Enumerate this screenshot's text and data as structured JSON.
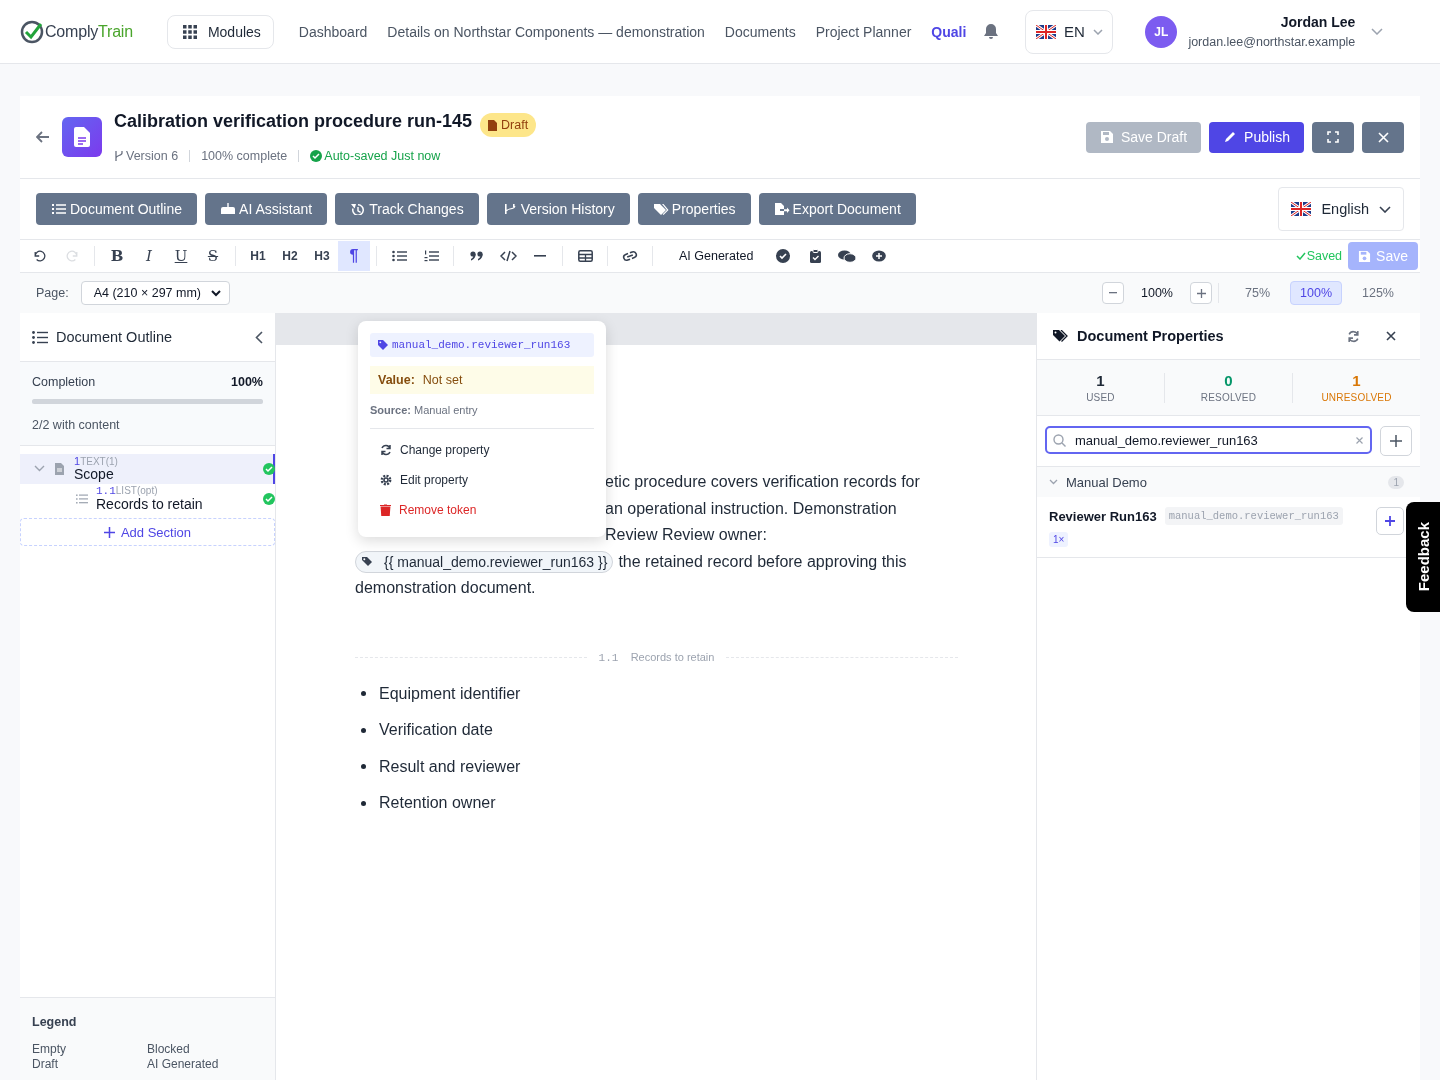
{
  "brand": {
    "name_a": "Comply",
    "name_b": "Train"
  },
  "nav": {
    "modules": "Modules",
    "links": [
      {
        "label": "Dashboard",
        "selected": false
      },
      {
        "label": "Details on Northstar Components — demonstration",
        "selected": false
      },
      {
        "label": "Documents",
        "selected": false
      },
      {
        "label": "Project Planner",
        "selected": false
      },
      {
        "label": "Quali",
        "selected": true
      }
    ]
  },
  "language": {
    "code": "EN"
  },
  "user": {
    "initials": "JL",
    "name": "Jordan Lee",
    "email": "jordan.lee@northstar.example"
  },
  "document": {
    "title": "Calibration verification procedure run-145",
    "status": "Draft",
    "version": "Version 6",
    "completion": "100% complete",
    "autosave": "Auto-saved Just now"
  },
  "actions": [
    {
      "kind": "save",
      "label": "Save Draft",
      "disabled": true
    },
    {
      "kind": "publish",
      "label": "Publish",
      "disabled": false
    },
    {
      "kind": "fullscreen",
      "disabled": false
    },
    {
      "kind": "close",
      "disabled": false
    }
  ],
  "panel_buttons": [
    "Document Outline",
    "AI Assistant",
    "Track Changes",
    "Version History",
    "Properties",
    "Export Document"
  ],
  "content_language": "English",
  "format_toolbar": {
    "history": [
      {
        "disabled": false
      },
      {
        "disabled": true
      }
    ],
    "marks": [
      "B",
      "I",
      "U",
      "S"
    ],
    "headings": [
      {
        "label": "H1",
        "selected": false
      },
      {
        "label": "H2",
        "selected": false
      },
      {
        "label": "H3",
        "selected": false
      },
      {
        "label": "¶",
        "selected": true
      }
    ],
    "ai_label": "AI Generated",
    "saved": "Saved",
    "save": {
      "label": "Save",
      "disabled": true
    }
  },
  "page_setup": {
    "label": "Page:",
    "size": "A4 (210 × 297 mm)",
    "zoom": "100%",
    "presets": [
      {
        "label": "75%",
        "selected": false
      },
      {
        "label": "100%",
        "selected": true
      },
      {
        "label": "125%",
        "selected": false
      }
    ]
  },
  "outline": {
    "title": "Document Outline",
    "completion_label": "Completion",
    "completion": "100%",
    "level": 1,
    "with_content": "2/2 with content",
    "sections": [
      {
        "number": "1",
        "type": "TEXT(1)",
        "title": "Scope",
        "selected": true,
        "expanded": true,
        "complete": true,
        "children": [
          {
            "number": "1.1",
            "type": "LIST(opt)",
            "title": "Records to retain",
            "selected": false,
            "complete": true
          }
        ]
      }
    ],
    "add": "Add Section",
    "legend_title": "Legend",
    "legend": [
      "Empty",
      "Blocked",
      "Draft",
      "AI Generated"
    ]
  },
  "editor": {
    "lines": [
      "etic procedure covers verification records for",
      "an operational instruction. Demonstration",
      "Review Review owner:"
    ],
    "token": "{{ manual_demo.reviewer_run163 }}",
    "token_after": "the retained record before approving this",
    "last_line": "demonstration document.",
    "divider": {
      "number": "1.1",
      "title": "Records to retain"
    },
    "bullets": [
      "Equipment identifier",
      "Verification date",
      "Result and reviewer",
      "Retention owner"
    ]
  },
  "popup": {
    "key": "manual_demo.reviewer_run163",
    "value_label": "Value:",
    "value": "Not set",
    "source": "**Source:** Manual entry",
    "items": [
      {
        "kind": "change",
        "label": "Change property"
      },
      {
        "kind": "edit",
        "label": "Edit property"
      },
      {
        "kind": "remove",
        "label": "Remove token"
      }
    ]
  },
  "properties": {
    "title": "Document Properties",
    "stats": [
      {
        "kind": "used",
        "value": "1",
        "label": "USED"
      },
      {
        "kind": "resolved",
        "value": "0",
        "label": "RESOLVED"
      },
      {
        "kind": "unresolved",
        "value": "1",
        "label": "UNRESOLVED"
      }
    ],
    "search": "manual_demo.reviewer_run163",
    "groups": [
      {
        "name": "Manual Demo",
        "count": "1",
        "expanded": true,
        "items": [
          {
            "name": "Reviewer Run163",
            "key": "manual_demo.reviewer_run163",
            "uses": "1×"
          }
        ]
      }
    ]
  },
  "feedback": "Feedback"
}
